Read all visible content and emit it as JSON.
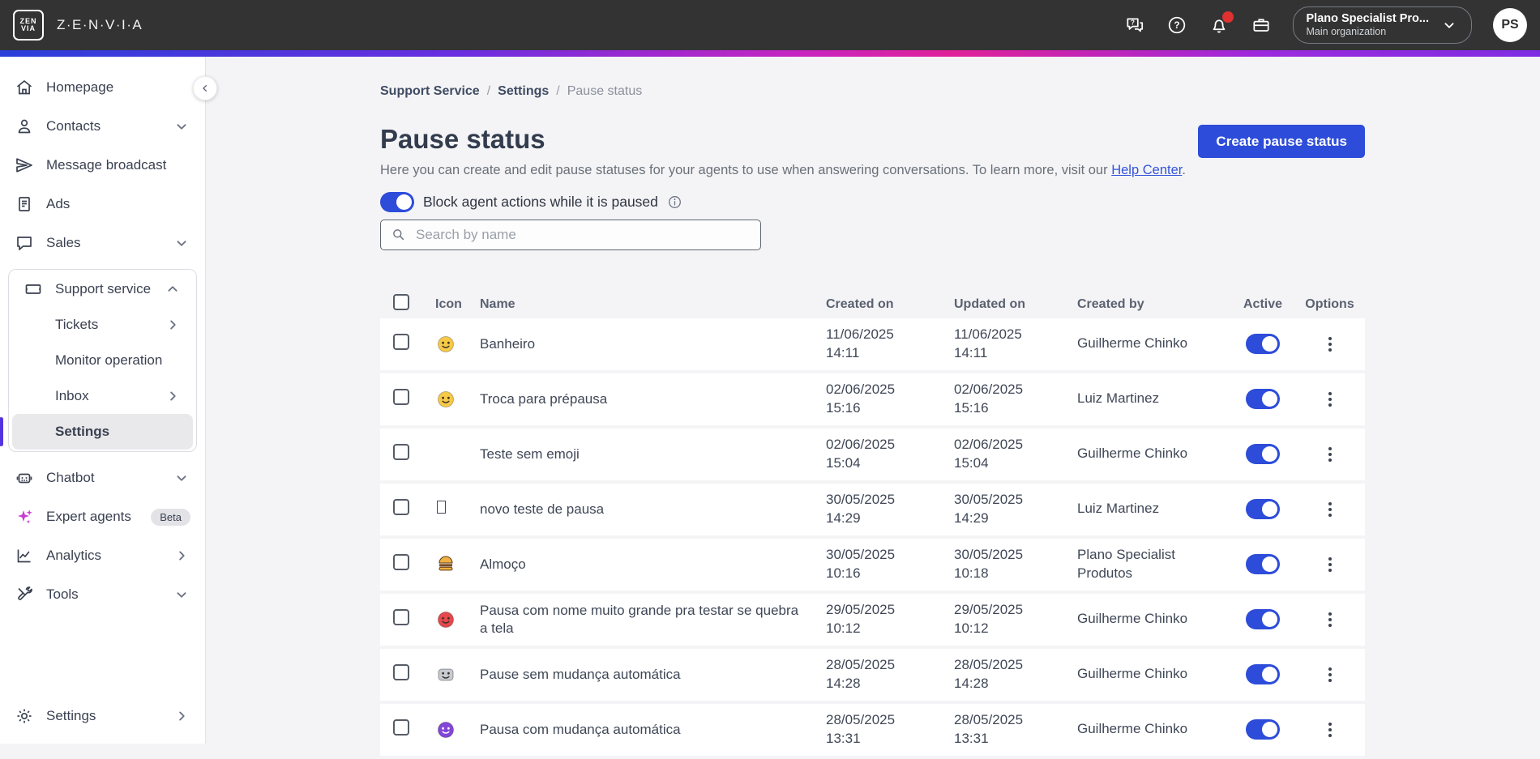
{
  "colors": {
    "accent": "#2d4cd9",
    "link": "#3353d9",
    "topbar_bg": "#333333",
    "selected_indicator": "#5334e0",
    "notification_dot": "#e03131"
  },
  "topbar": {
    "logo_lines": [
      "ZEN",
      "VIA"
    ],
    "brand": "Z·E·N·V·I·A",
    "org": {
      "name": "Plano Specialist Pro...",
      "subtitle": "Main organization"
    },
    "avatar": "PS"
  },
  "sidebar": {
    "items": [
      {
        "label": "Homepage"
      },
      {
        "label": "Contacts"
      },
      {
        "label": "Message broadcast"
      },
      {
        "label": "Ads"
      },
      {
        "label": "Sales"
      }
    ],
    "support_group": {
      "label": "Support service",
      "children": [
        {
          "label": "Tickets"
        },
        {
          "label": "Monitor operation"
        },
        {
          "label": "Inbox"
        },
        {
          "label": "Settings",
          "selected": true
        }
      ]
    },
    "lower": [
      {
        "label": "Chatbot"
      },
      {
        "label": "Expert agents",
        "badge": "Beta"
      },
      {
        "label": "Analytics"
      },
      {
        "label": "Tools"
      }
    ],
    "bottom": {
      "label": "Settings"
    }
  },
  "breadcrumb": [
    "Support Service",
    "Settings",
    "Pause status"
  ],
  "page": {
    "title": "Pause status",
    "description_prefix": "Here you can create and edit pause statuses for your agents to use when answering conversations. To learn more, visit our ",
    "description_link": "Help Center",
    "description_suffix": ".",
    "create_button": "Create pause status",
    "block_toggle_label": "Block agent actions while it is paused",
    "block_toggle_on": true,
    "search_placeholder": "Search by name"
  },
  "table": {
    "headers": [
      "Icon",
      "Name",
      "Created on",
      "Updated on",
      "Created by",
      "Active",
      "Options"
    ],
    "rows": [
      {
        "icon": {
          "glyph": "😆",
          "kind": "face",
          "color": "#f7c948"
        },
        "name": "Banheiro",
        "created_date": "11/06/2025",
        "created_time": "14:11",
        "updated_date": "11/06/2025",
        "updated_time": "14:11",
        "created_by": "Guilherme Chinko",
        "active": true
      },
      {
        "icon": {
          "glyph": "🙄",
          "kind": "face",
          "color": "#f7c948"
        },
        "name": "Troca para prépausa",
        "created_date": "02/06/2025",
        "created_time": "15:16",
        "updated_date": "02/06/2025",
        "updated_time": "15:16",
        "created_by": "Luiz Martinez",
        "active": true
      },
      {
        "icon": {
          "glyph": "",
          "kind": "none",
          "color": ""
        },
        "name": "Teste sem emoji",
        "created_date": "02/06/2025",
        "created_time": "15:04",
        "updated_date": "02/06/2025",
        "updated_time": "15:04",
        "created_by": "Guilherme Chinko",
        "active": true
      },
      {
        "icon": {
          "glyph": "▯",
          "kind": "box",
          "color": ""
        },
        "name": "novo teste de pausa",
        "created_date": "30/05/2025",
        "created_time": "14:29",
        "updated_date": "30/05/2025",
        "updated_time": "14:29",
        "created_by": "Luiz Martinez",
        "active": true
      },
      {
        "icon": {
          "glyph": "🍔",
          "kind": "burger",
          "color": "#f0b043"
        },
        "name": "Almoço",
        "created_date": "30/05/2025",
        "created_time": "10:16",
        "updated_date": "30/05/2025",
        "updated_time": "10:18",
        "created_by": "Plano Specialist Produtos",
        "active": true
      },
      {
        "icon": {
          "glyph": "🥵",
          "kind": "face",
          "color": "#e5484d"
        },
        "name": "Pausa com nome muito grande pra testar se quebra a tela",
        "created_date": "29/05/2025",
        "created_time": "10:12",
        "updated_date": "29/05/2025",
        "updated_time": "10:12",
        "created_by": "Guilherme Chinko",
        "active": true
      },
      {
        "icon": {
          "glyph": "🤖",
          "kind": "robot",
          "color": "#c8ccd2"
        },
        "name": "Pause sem mudança automática",
        "created_date": "28/05/2025",
        "created_time": "14:28",
        "updated_date": "28/05/2025",
        "updated_time": "14:28",
        "created_by": "Guilherme Chinko",
        "active": true
      },
      {
        "icon": {
          "glyph": "👾",
          "kind": "monster",
          "color": "#8247d6"
        },
        "name": "Pausa com mudança automática",
        "created_date": "28/05/2025",
        "created_time": "13:31",
        "updated_date": "28/05/2025",
        "updated_time": "13:31",
        "created_by": "Guilherme Chinko",
        "active": true
      }
    ]
  }
}
